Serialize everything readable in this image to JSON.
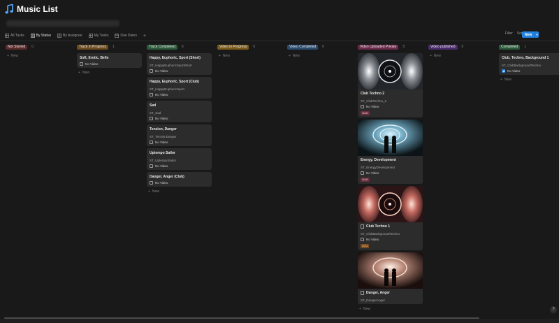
{
  "page": {
    "title": "Music List"
  },
  "tabs": [
    {
      "label": "All Tasks",
      "icon": "table-icon"
    },
    {
      "label": "By Status",
      "icon": "board-icon",
      "active": true
    },
    {
      "label": "By Assignee",
      "icon": "board-icon"
    },
    {
      "label": "My Tasks",
      "icon": "table-icon"
    },
    {
      "label": "Due Dates",
      "icon": "calendar-icon"
    }
  ],
  "toolbar": {
    "filter": "Filter",
    "sort": "Sort",
    "more": "···",
    "new": "New",
    "add_tab": "+"
  },
  "add_new": "New",
  "columns": [
    {
      "label": "Not Started",
      "count": "0",
      "color": "#5a2a2a",
      "cards": []
    },
    {
      "label": "Track in Progress",
      "count": "1",
      "color": "#6b4a1d",
      "cards": [
        {
          "title": "Soft, Erotic, Bells",
          "check": "No Video",
          "checked": false
        }
      ]
    },
    {
      "label": "Track Completed",
      "count": "6",
      "color": "#2b5a3a",
      "cards": [
        {
          "title": "Happy, Euphoric, Sport (Short)",
          "sub": "ST_HappyEuphoricSportShort",
          "check": "No Video",
          "checked": false
        },
        {
          "title": "Happy, Euphoric, Sport (Club)",
          "sub": "ST_HappyEuphoricSport",
          "check": "No Video",
          "checked": false
        },
        {
          "title": "Sad",
          "sub": "ST_Sad",
          "check": "No Video",
          "checked": false
        },
        {
          "title": "Tension, Danger",
          "sub": "ST_TensionDanger",
          "check": "No Video",
          "checked": false
        },
        {
          "title": "Uptempo Sailor",
          "sub": "ST_UptempoSailor",
          "check": "No Video",
          "checked": false
        },
        {
          "title": "Danger, Anger (Club)",
          "check": "No Video",
          "checked": false
        }
      ]
    },
    {
      "label": "Video in Progress",
      "count": "0",
      "color": "#7a5a1a",
      "cards": []
    },
    {
      "label": "Video Completed",
      "count": "0",
      "color": "#2a4a6e",
      "cards": []
    },
    {
      "label": "Video Uploaded Private",
      "count": "5",
      "color": "#6a2a4a",
      "cards": [
        {
          "thumb": "ears",
          "title": "Club Techno 2",
          "sub": "ST_ClubTechno_2",
          "check": "No Video",
          "checked": false,
          "tag": "GAG",
          "tag_color": "pink"
        },
        {
          "thumb": "figures",
          "title": "Energy, Development",
          "sub": "ST_EnergyDevelopment",
          "check": "No Video",
          "checked": false,
          "tag": "GAG",
          "tag_color": "pink"
        },
        {
          "thumb": "ears-warm",
          "title": "Club Techno 1",
          "doc": true,
          "sub": "ST_ClubBackgroundTechno",
          "check": "No Video",
          "checked": false,
          "tag": "G2G",
          "tag_color": "orange"
        },
        {
          "thumb": "figures-warm",
          "title": "Danger, Anger",
          "doc": true,
          "sub": "ST_DangerAnger"
        }
      ]
    },
    {
      "label": "Video published",
      "count": "0",
      "color": "#4a2a6a",
      "cards": []
    },
    {
      "label": "Completed",
      "count": "1",
      "color": "#2b5a3a",
      "cards": [
        {
          "title": "Club, Techno, Background 1",
          "sub": "ST_ClubBackgroundTechno",
          "check": "No Video",
          "checked": true
        }
      ]
    }
  ],
  "help": "?"
}
